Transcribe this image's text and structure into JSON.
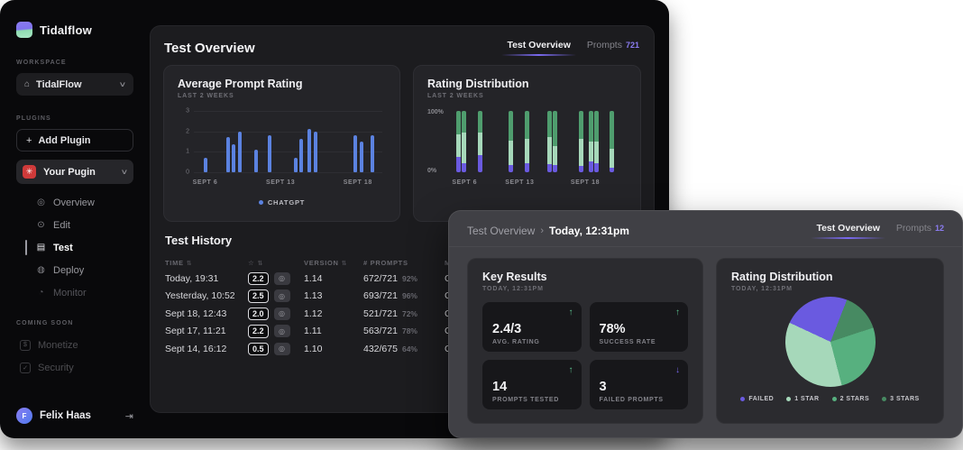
{
  "brand": {
    "name": "Tidalflow"
  },
  "sidebar": {
    "workspace_label": "WORKSPACE",
    "workspace": {
      "name": "TidalFlow",
      "icon": "home-icon"
    },
    "plugins_label": "PLUGINS",
    "add_plugin_label": "Add Plugin",
    "plugin": {
      "name": "Your Pugin",
      "icon": "burst-icon"
    },
    "nav_items": [
      {
        "label": "Overview",
        "icon": "target-icon",
        "state": "default"
      },
      {
        "label": "Edit",
        "icon": "edit-icon",
        "state": "default"
      },
      {
        "label": "Test",
        "icon": "test-icon",
        "state": "active"
      },
      {
        "label": "Deploy",
        "icon": "deploy-icon",
        "state": "default"
      },
      {
        "label": "Monitor",
        "icon": "monitor-icon",
        "state": "disabled"
      }
    ],
    "coming_soon_label": "COMING SOON",
    "coming_soon_items": [
      {
        "label": "Monetize",
        "icon": "monetize-icon",
        "glyph": "$"
      },
      {
        "label": "Security",
        "icon": "security-icon",
        "glyph": "✓"
      }
    ],
    "user": {
      "initial": "F",
      "name": "Felix Haas"
    }
  },
  "main": {
    "title": "Test Overview",
    "tabs": [
      {
        "label": "Test Overview",
        "active": true
      },
      {
        "label": "Prompts",
        "count": "721",
        "active": false
      }
    ],
    "avg_chart": {
      "title": "Average Prompt Rating",
      "subtitle": "LAST 2 WEEKS",
      "legend": "CHATGPT"
    },
    "dist_chart": {
      "title": "Rating Distribution",
      "subtitle": "LAST 2 WEEKS"
    },
    "history": {
      "title": "Test History",
      "columns": {
        "time": "TIME",
        "rating": "☆",
        "version": "VERSION",
        "prompts": "# PROMPTS",
        "model": "MODEL"
      },
      "rows": [
        {
          "time": "Today, 19:31",
          "rating": "2.2",
          "version": "1.14",
          "prompts": "672/721",
          "pct": "92%",
          "model": "ChatGPT"
        },
        {
          "time": "Yesterday, 10:52",
          "rating": "2.5",
          "version": "1.13",
          "prompts": "693/721",
          "pct": "96%",
          "model": "ChatGPT"
        },
        {
          "time": "Sept 18, 12:43",
          "rating": "2.0",
          "version": "1.12",
          "prompts": "521/721",
          "pct": "72%",
          "model": "ChatGPT"
        },
        {
          "time": "Sept 17, 11:21",
          "rating": "2.2",
          "version": "1.11",
          "prompts": "563/721",
          "pct": "78%",
          "model": "ChatGPT"
        },
        {
          "time": "Sept 14, 16:12",
          "rating": "0.5",
          "version": "1.10",
          "prompts": "432/675",
          "pct": "64%",
          "model": "ChatGPT"
        }
      ]
    }
  },
  "modal": {
    "breadcrumb": {
      "parent": "Test Overview",
      "separator": "›",
      "current": "Today, 12:31pm"
    },
    "tabs": [
      {
        "label": "Test Overview",
        "active": true
      },
      {
        "label": "Prompts",
        "count": "12",
        "active": false
      }
    ],
    "key_results": {
      "title": "Key Results",
      "subtitle": "TODAY, 12:31PM",
      "metrics": [
        {
          "value": "2.4/3",
          "label": "AVG. RATING",
          "direction": "up"
        },
        {
          "value": "78%",
          "label": "SUCCESS RATE",
          "direction": "up"
        },
        {
          "value": "14",
          "label": "PROMPTS TESTED",
          "direction": "up"
        },
        {
          "value": "3",
          "label": "FAILED PROMPTS",
          "direction": "down"
        }
      ]
    },
    "pie_card": {
      "title": "Rating Distribution",
      "subtitle": "TODAY, 12:31PM"
    }
  },
  "colors": {
    "chart_blue": "#5b82e0",
    "purple": "#6a5ae0",
    "mint": "#a6d8ba",
    "green_mid": "#57b07f",
    "green_dark": "#478a62",
    "accent": "#8b7cf0",
    "up_green": "#5bc08d"
  },
  "chart_data": [
    {
      "type": "bar",
      "title": "Average Prompt Rating",
      "subtitle": "LAST 2 WEEKS",
      "series": [
        {
          "name": "CHATGPT",
          "color": "#5b82e0"
        }
      ],
      "ylim": [
        0,
        3
      ],
      "yticks": [
        0,
        1,
        2,
        3
      ],
      "xticks": [
        {
          "label": "SEPT 6",
          "pos": 0.06
        },
        {
          "label": "SEPT 13",
          "pos": 0.46
        },
        {
          "label": "SEPT 18",
          "pos": 0.87
        }
      ],
      "bars": [
        {
          "x": 0.051,
          "value": 0.7
        },
        {
          "x": 0.171,
          "value": 1.7
        },
        {
          "x": 0.199,
          "value": 1.35
        },
        {
          "x": 0.234,
          "value": 2.0
        },
        {
          "x": 0.321,
          "value": 1.1
        },
        {
          "x": 0.391,
          "value": 1.8
        },
        {
          "x": 0.533,
          "value": 0.7
        },
        {
          "x": 0.559,
          "value": 1.65
        },
        {
          "x": 0.601,
          "value": 2.1
        },
        {
          "x": 0.638,
          "value": 2.0
        },
        {
          "x": 0.847,
          "value": 1.8
        },
        {
          "x": 0.879,
          "value": 1.5
        },
        {
          "x": 0.937,
          "value": 1.8
        }
      ]
    },
    {
      "type": "stacked-bar",
      "title": "Rating Distribution",
      "subtitle": "LAST 2 WEEKS",
      "ylim_labels": [
        "0%",
        "100%"
      ],
      "colors": {
        "failed": "#6a5ae0",
        "mid": "#a6d8ba",
        "top": "#4f9d6e"
      },
      "xticks": [
        {
          "label": "SEPT 6",
          "pos": 0.08
        },
        {
          "label": "SEPT 13",
          "pos": 0.4
        },
        {
          "label": "SEPT 18",
          "pos": 0.78
        }
      ],
      "bars": [
        {
          "x": 0.03,
          "failed": 25,
          "mid": 37
        },
        {
          "x": 0.063,
          "failed": 15,
          "mid": 50
        },
        {
          "x": 0.157,
          "failed": 28,
          "mid": 37
        },
        {
          "x": 0.336,
          "failed": 12,
          "mid": 40
        },
        {
          "x": 0.43,
          "failed": 15,
          "mid": 40
        },
        {
          "x": 0.56,
          "failed": 13,
          "mid": 45
        },
        {
          "x": 0.59,
          "failed": 12,
          "mid": 30
        },
        {
          "x": 0.743,
          "failed": 10,
          "mid": 45
        },
        {
          "x": 0.803,
          "failed": 18,
          "mid": 32
        },
        {
          "x": 0.831,
          "failed": 15,
          "mid": 35
        },
        {
          "x": 0.922,
          "failed": 8,
          "mid": 30
        }
      ]
    },
    {
      "type": "pie",
      "title": "Rating Distribution (Today, 12:31PM)",
      "start_angle": 295,
      "slices": [
        {
          "label": "FAILED",
          "value": 24,
          "color": "#6a5ae0"
        },
        {
          "label": "3 STARS",
          "value": 14,
          "color": "#478a62"
        },
        {
          "label": "2 STARS",
          "value": 26,
          "color": "#57b07f"
        },
        {
          "label": "1 STAR",
          "value": 36,
          "color": "#a6d8ba"
        }
      ],
      "legend": [
        {
          "label": "FAILED",
          "color": "#6a5ae0"
        },
        {
          "label": "1 STAR",
          "color": "#a6d8ba"
        },
        {
          "label": "2 STARS",
          "color": "#57b07f"
        },
        {
          "label": "3 STARS",
          "color": "#478a62"
        }
      ]
    }
  ]
}
